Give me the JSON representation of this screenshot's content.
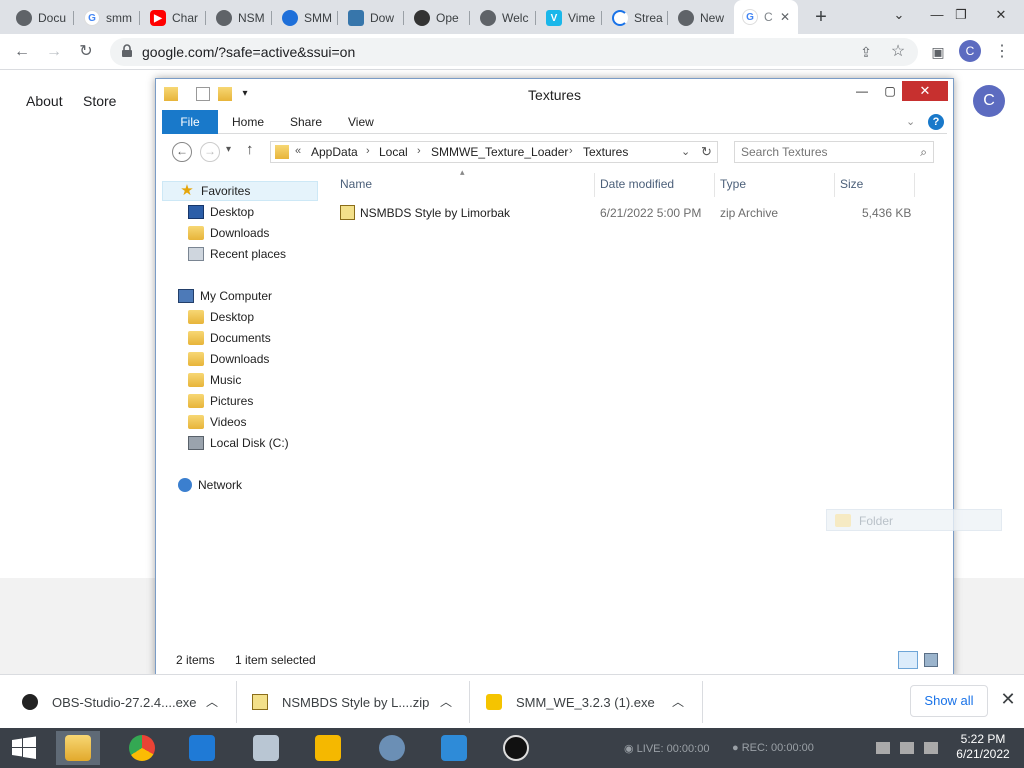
{
  "browser": {
    "tabs": [
      {
        "label": "Docu",
        "color": "#5f6368"
      },
      {
        "label": "smm",
        "color": "#4285f4"
      },
      {
        "label": "Char",
        "color": "#ff0000"
      },
      {
        "label": "NSM",
        "color": "#5f6368"
      },
      {
        "label": "SMM",
        "color": "#1e6fd9"
      },
      {
        "label": "Dow",
        "color": "#3776ab"
      },
      {
        "label": "Ope",
        "color": "#333333"
      },
      {
        "label": "Welc",
        "color": "#5f6368"
      },
      {
        "label": "Vime",
        "color": "#1ab7ea"
      },
      {
        "label": "Strea",
        "color": "#1a73e8"
      },
      {
        "label": "New",
        "color": "#5f6368"
      },
      {
        "label": "C",
        "color": "#4285f4"
      }
    ],
    "new_tab": "+",
    "window_controls": {
      "dropdown": "⌄",
      "minimize": "—",
      "restore": "❐",
      "close": "✕"
    },
    "url": "google.com/?safe=active&ssui=on",
    "profile_initial": "C"
  },
  "google_page": {
    "links": [
      "About",
      "Store"
    ],
    "avatar_initial": "C"
  },
  "explorer": {
    "title": "Textures",
    "ribbon_tabs": [
      "File",
      "Home",
      "Share",
      "View"
    ],
    "breadcrumb": [
      "AppData",
      "Local",
      "SMMWE_Texture_Loader",
      "Textures"
    ],
    "breadcrumb_prefix": "«",
    "search_placeholder": "Search Textures",
    "nav": {
      "favorites": "Favorites",
      "favorites_items": [
        "Desktop",
        "Downloads",
        "Recent places"
      ],
      "computer": "My Computer",
      "computer_items": [
        "Desktop",
        "Documents",
        "Downloads",
        "Music",
        "Pictures",
        "Videos",
        "Local Disk (C:)"
      ],
      "network": "Network"
    },
    "columns": [
      "Name",
      "Date modified",
      "Type",
      "Size"
    ],
    "files": [
      {
        "name": "NSMBDS Style by Limorbak",
        "date": "6/21/2022 5:00 PM",
        "type": "zip Archive",
        "size": "5,436 KB"
      }
    ],
    "drag_ghost_label": "Folder",
    "status": {
      "items": "2 items",
      "selected": "1 item selected"
    }
  },
  "downloads": {
    "items": [
      {
        "name": "OBS-Studio-27.2.4....exe"
      },
      {
        "name": "NSMBDS Style by L....zip"
      },
      {
        "name": "SMM_WE_3.2.3 (1).exe"
      }
    ],
    "show_all": "Show all"
  },
  "taskbar": {
    "live": "LIVE: 00:00:00",
    "rec": "REC: 00:00:00",
    "time": "5:22 PM",
    "date": "6/21/2022"
  }
}
